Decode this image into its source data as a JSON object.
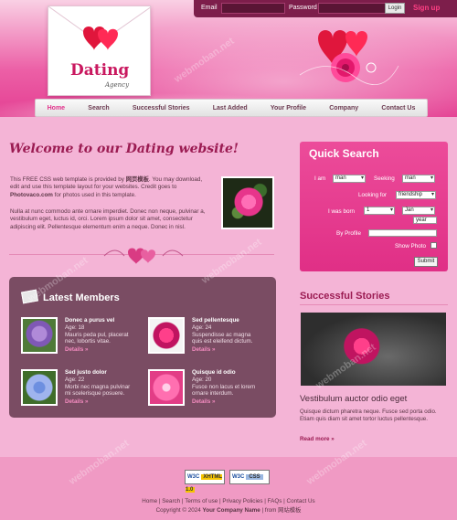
{
  "login": {
    "email_label": "Email",
    "password_label": "Password",
    "login_button": "Login",
    "signup": "Sign up"
  },
  "logo": {
    "title": "Dating",
    "subtitle": "Agency"
  },
  "nav": [
    "Home",
    "Search",
    "Successful Stories",
    "Last Added",
    "Your Profile",
    "Company",
    "Contact Us"
  ],
  "welcome": {
    "title": "Welcome to our Dating website!",
    "p1_a": "This FREE CSS web template is provided by ",
    "p1_brand": "网页模板",
    "p1_b": ". You may download, edit and use this template layout for your websites. Credit goes to ",
    "p1_site": "Photovaco.com",
    "p1_c": " for photos used in this template.",
    "p2": "Nulla at nunc commodo ante ornare imperdiet. Donec non neque, pulvinar a, vestibulum eget, luctus id, orci. Lorem ipsum dolor sit amet, consectetur adipiscing elit. Pellentesque elementum enim a neque. Donec in nisl."
  },
  "quick_search": {
    "title": "Quick Search",
    "i_am_label": "I am",
    "i_am_value": "man",
    "seeking_label": "Seeking",
    "seeking_value": "man",
    "looking_for_label": "Looking for",
    "looking_for_value": "friendship",
    "born_label": "I was born",
    "born_day": "1",
    "born_month": "Jan",
    "born_year": "year",
    "by_profile_label": "By Profile",
    "show_photo_label": "Show Photo",
    "submit": "Submit"
  },
  "latest_members": {
    "title": "Latest Members",
    "members": [
      {
        "name": "Donec a purus vel",
        "age": "Age: 18",
        "line1": "Mauris peda pul, placerat",
        "line2": "nec, lobortis vitae.",
        "details": "Details »"
      },
      {
        "name": "Sed pellentesque",
        "age": "Age: 24",
        "line1": "Suspendisse ac magna",
        "line2": "quis est eleifend dictum.",
        "details": "Details »"
      },
      {
        "name": "Sed justo dolor",
        "age": "Age: 22",
        "line1": "Morbi nec magna pulvinar",
        "line2": "mi scelerisque posuere.",
        "details": "Details »"
      },
      {
        "name": "Quisque id odio",
        "age": "Age: 20",
        "line1": "Fusce non lacus et lorem",
        "line2": "ornare interdum.",
        "details": "Details »"
      }
    ]
  },
  "stories": {
    "title": "Successful Stories",
    "subtitle": "Vestibulum auctor odio eget",
    "text": "Quisque dictum pharetra neque. Fusce sed porta odio. Etiam quis diam sit amet tortor luctus pellentesque.",
    "more": "Read more »"
  },
  "footer": {
    "badge1_a": "W3C",
    "badge1_b": "XHTML 1.0",
    "badge2_a": "W3C",
    "badge2_b": "CSS",
    "links": [
      "Home",
      "Search",
      "Terms of use",
      "Privacy Policies",
      "FAQs",
      "Contact Us"
    ],
    "copyright_a": "Copyright © 2024 ",
    "company": "Your Company Name",
    "copyright_b": " | from 网站模板"
  },
  "watermark": "webmoban.net",
  "colors": {
    "accent": "#e2308a",
    "dark": "#7a4c63",
    "title": "#9b1b52"
  }
}
